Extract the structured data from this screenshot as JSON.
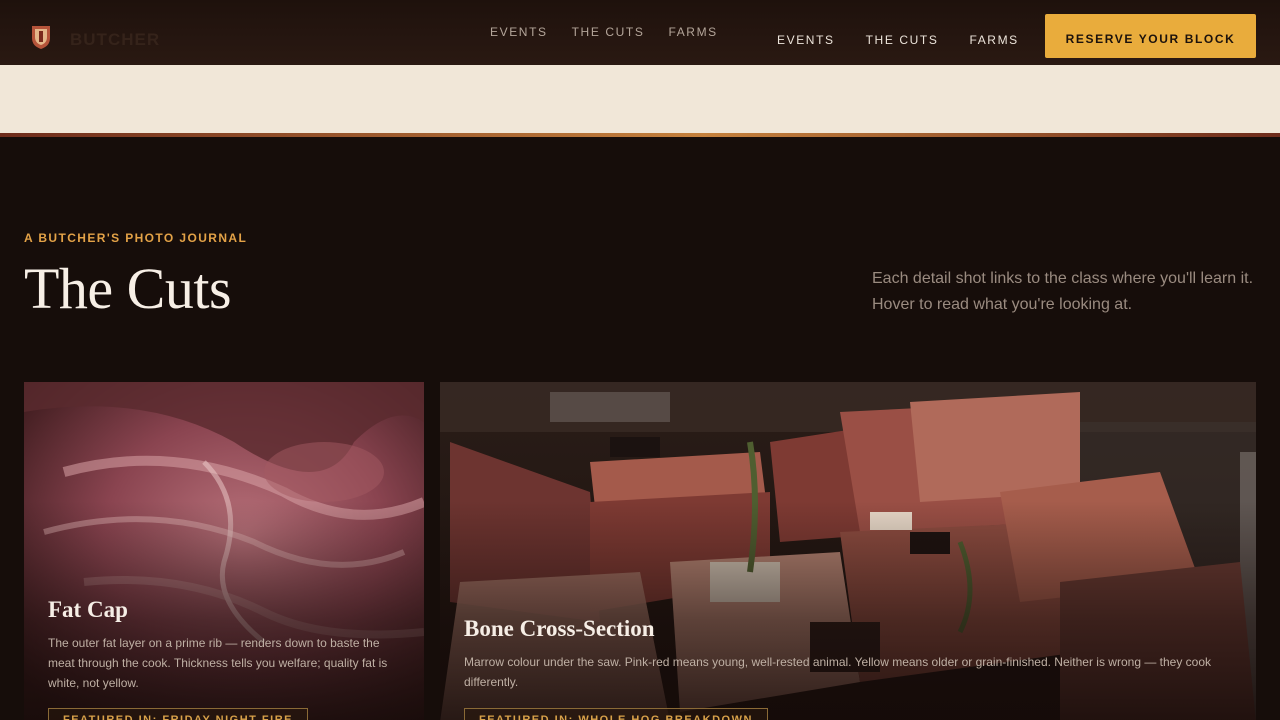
{
  "header": {
    "logo_icon": "butcher-crest-icon",
    "logo_text": "BUTCHER",
    "nav_ghost": [
      "EVENTS",
      "THE CUTS",
      "FARMS"
    ],
    "nav": [
      "EVENTS",
      "THE CUTS",
      "FARMS"
    ],
    "cta_label": "RESERVE YOUR BLOCK"
  },
  "colors": {
    "accent": "#e9ac3c",
    "background": "#160d0a",
    "cream": "#f1e7d8"
  },
  "section": {
    "eyebrow": "A BUTCHER'S PHOTO JOURNAL",
    "title": "The Cuts",
    "intro": "Each detail shot links to the class where you'll learn it. Hover to read what you're looking at."
  },
  "cards": [
    {
      "title": "Fat Cap",
      "description": "The outer fat layer on a prime rib — renders down to baste the meat through the cook. Thickness tells you welfare; quality fat is white, not yellow.",
      "featured": "FEATURED IN: FRIDAY NIGHT FIRE",
      "image": "raw-prime-rib-closeup"
    },
    {
      "title": "Bone Cross-Section",
      "description": "Marrow colour under the saw. Pink-red means young, well-rested animal. Yellow means older or grain-finished. Neither is wrong — they cook differently.",
      "featured": "FEATURED IN: WHOLE HOG BREAKDOWN",
      "image": "butcher-display-case"
    }
  ]
}
